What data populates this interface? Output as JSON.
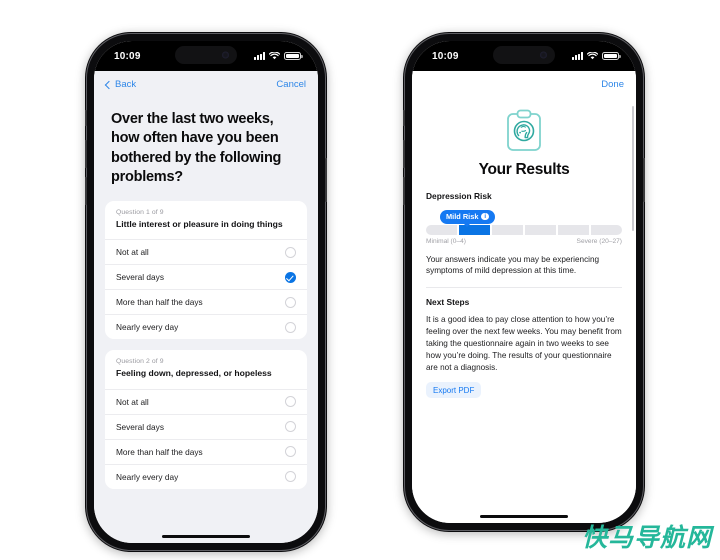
{
  "watermark": {
    "text": "快马导航网",
    "color": "#25b79a"
  },
  "phones": {
    "left": {
      "status": {
        "time": "10:09",
        "signal_icon": "cellular-signal-icon",
        "wifi_icon": "wifi-icon",
        "battery_icon": "battery-icon"
      },
      "nav": {
        "back_label": "Back",
        "cancel_label": "Cancel"
      },
      "headline": "Over the last two weeks, how often have you been bothered by the following problems?",
      "questions": [
        {
          "number_label": "Question 1 of 9",
          "text": "Little interest or pleasure in doing things",
          "options": [
            {
              "label": "Not at all",
              "selected": false
            },
            {
              "label": "Several days",
              "selected": true
            },
            {
              "label": "More than half the days",
              "selected": false
            },
            {
              "label": "Nearly every day",
              "selected": false
            }
          ]
        },
        {
          "number_label": "Question 2 of 9",
          "text": "Feeling down, depressed, or hopeless",
          "options": [
            {
              "label": "Not at all",
              "selected": false
            },
            {
              "label": "Several days",
              "selected": false
            },
            {
              "label": "More than half the days",
              "selected": false
            },
            {
              "label": "Nearly every day",
              "selected": false
            }
          ]
        }
      ]
    },
    "right": {
      "status": {
        "time": "10:09",
        "signal_icon": "cellular-signal-icon",
        "wifi_icon": "wifi-icon",
        "battery_icon": "battery-icon"
      },
      "nav": {
        "done_label": "Done"
      },
      "hero_icon": "clipboard-brain-icon",
      "title": "Your Results",
      "risk": {
        "section_label": "Depression Risk",
        "badge_label": "Mild Risk",
        "badge_info_icon": "info-icon",
        "badge_color": "#1579f2",
        "scale_segments": 6,
        "active_segment": 2,
        "min_label": "Minimal (0–4)",
        "max_label": "Severe (20–27)"
      },
      "summary_text": "Your answers indicate you may be experiencing symptoms of mild depression at this time.",
      "next_steps": {
        "heading": "Next Steps",
        "body": "It is a good idea to pay close attention to how you’re feeling over the next few weeks. You may benefit from taking the questionnaire again in two weeks to see how you’re doing. The results of your questionnaire are not a diagnosis."
      },
      "export_label": "Export PDF"
    }
  }
}
